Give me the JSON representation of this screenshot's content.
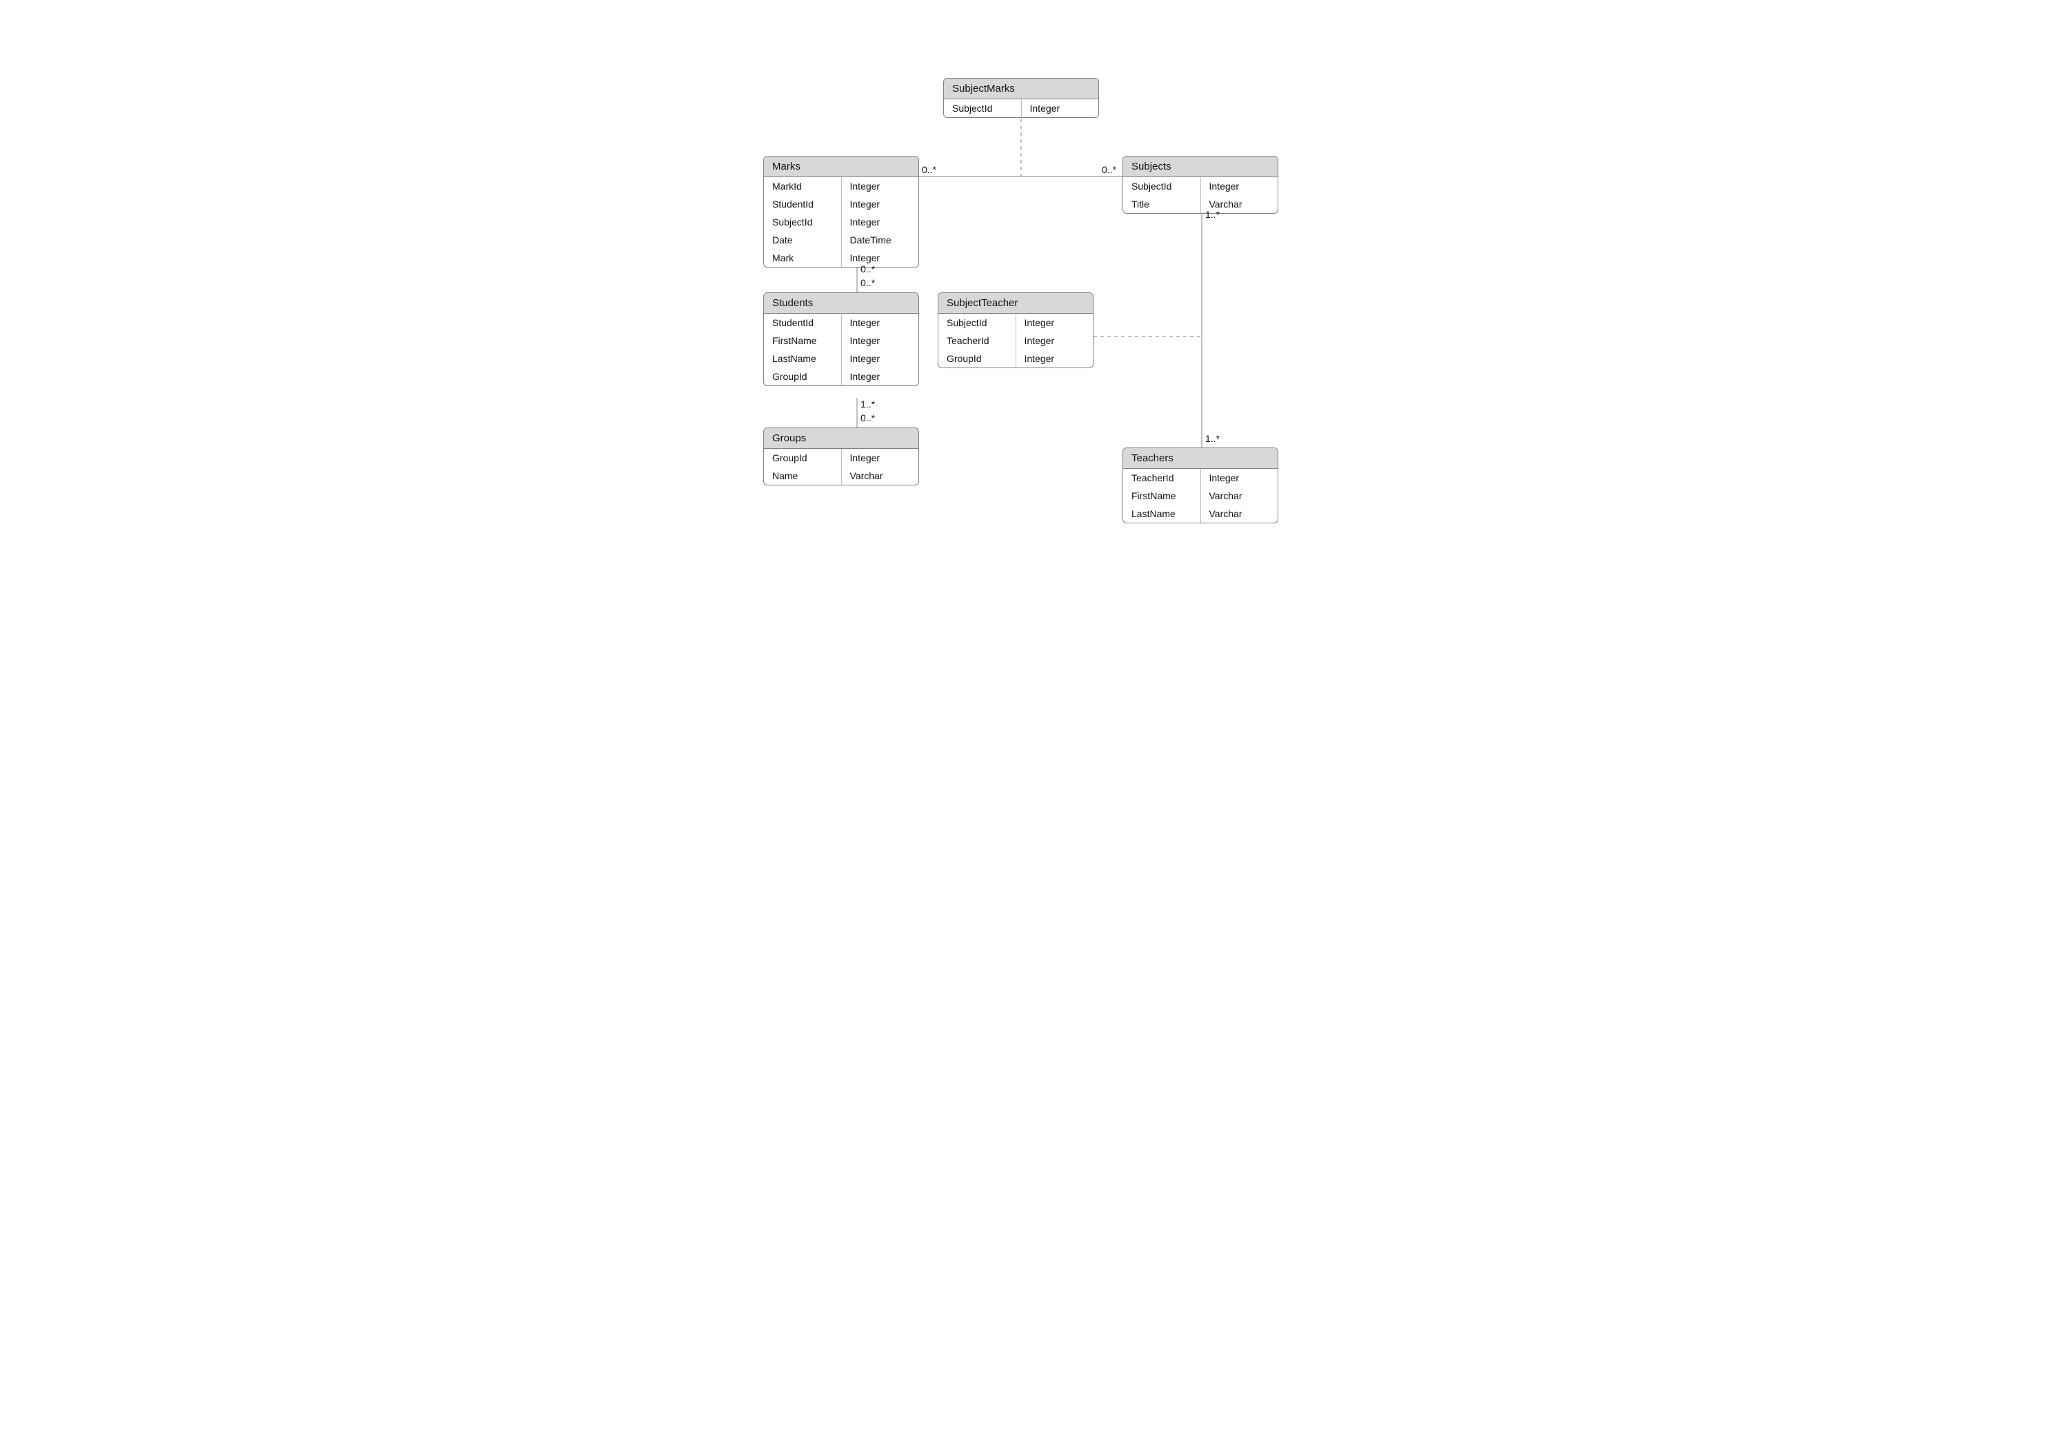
{
  "entities": {
    "subjectMarks": {
      "title": "SubjectMarks",
      "fields": [
        {
          "name": "SubjectId",
          "type": "Integer"
        }
      ]
    },
    "marks": {
      "title": "Marks",
      "fields": [
        {
          "name": "MarkId",
          "type": "Integer"
        },
        {
          "name": "StudentId",
          "type": "Integer"
        },
        {
          "name": "SubjectId",
          "type": "Integer"
        },
        {
          "name": "Date",
          "type": "DateTime"
        },
        {
          "name": "Mark",
          "type": "Integer"
        }
      ]
    },
    "subjects": {
      "title": "Subjects",
      "fields": [
        {
          "name": "SubjectId",
          "type": "Integer"
        },
        {
          "name": "Title",
          "type": "Varchar"
        }
      ]
    },
    "students": {
      "title": "Students",
      "fields": [
        {
          "name": "StudentId",
          "type": "Integer"
        },
        {
          "name": "FirstName",
          "type": "Integer"
        },
        {
          "name": "LastName",
          "type": "Integer"
        },
        {
          "name": "GroupId",
          "type": "Integer"
        }
      ]
    },
    "subjectTeacher": {
      "title": "SubjectTeacher",
      "fields": [
        {
          "name": "SubjectId",
          "type": "Integer"
        },
        {
          "name": "TeacherId",
          "type": "Integer"
        },
        {
          "name": "GroupId",
          "type": "Integer"
        }
      ]
    },
    "groups": {
      "title": "Groups",
      "fields": [
        {
          "name": "GroupId",
          "type": "Integer"
        },
        {
          "name": "Name",
          "type": "Varchar"
        }
      ]
    },
    "teachers": {
      "title": "Teachers",
      "fields": [
        {
          "name": "TeacherId",
          "type": "Integer"
        },
        {
          "name": "FirstName",
          "type": "Varchar"
        },
        {
          "name": "LastName",
          "type": "Varchar"
        }
      ]
    }
  },
  "multiplicities": {
    "marksToSubjectsLeft": "0..*",
    "marksToSubjectsRight": "0..*",
    "marksBottom": "0..*",
    "studentsTop": "0..*",
    "subjectsBottom": "1..*",
    "studentsBottom": "1..*",
    "groupsTop": "0..*",
    "teachersTop": "1..*"
  }
}
